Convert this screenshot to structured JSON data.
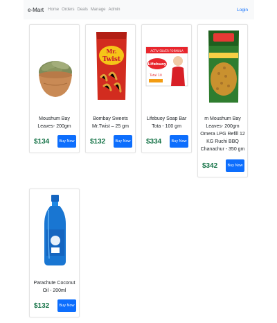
{
  "nav": {
    "brand": "e-Mart",
    "links": [
      "Home",
      "Orders",
      "Deals",
      "Manage",
      "Admin"
    ],
    "login": "Login"
  },
  "products": [
    {
      "name": "Moushum Bay Leaves- 200gm",
      "price": "$134",
      "buy_label": "Buy Now"
    },
    {
      "name": "Bombay Sweets Mr.Twist – 25 gm",
      "price": "$132",
      "buy_label": "Buy Now",
      "package_text": [
        "Mr.",
        "Twist"
      ]
    },
    {
      "name": "Lifebuoy Soap Bar Tota - 100 gm",
      "price": "$334",
      "buy_label": "Buy Now",
      "package_text": [
        "ACTIV SILVER FORMULA",
        "Lifebuoy",
        "Total 10"
      ]
    },
    {
      "name": "m Moushum Bay Leaves- 200gm Omera LPG Refill 12 KG Ruchi BBQ Chanachur - 350 gm",
      "price": "$342",
      "buy_label": "Buy Now"
    },
    {
      "name": "Parachute Coconut Oil - 200ml",
      "price": "$132",
      "buy_label": "Buy Now"
    }
  ],
  "colors": {
    "accent": "#0d6efd",
    "price": "#157347",
    "navbar_bg": "#f8f9fa"
  }
}
